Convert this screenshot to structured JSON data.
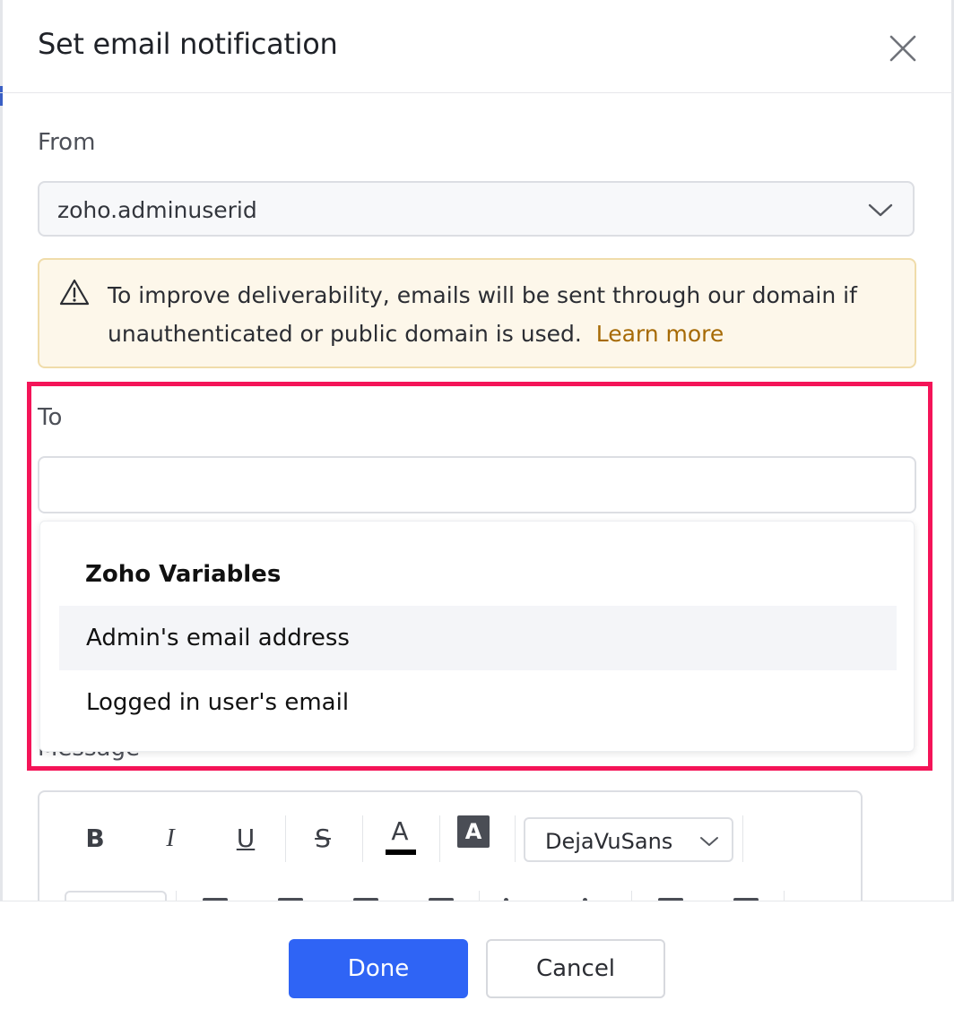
{
  "dialog": {
    "title": "Set email notification"
  },
  "from": {
    "label": "From",
    "selected": "zoho.adminuserid"
  },
  "warning": {
    "text": "To improve deliverability, emails will be sent through our domain if unauthenticated or public domain is used.",
    "link": "Learn more"
  },
  "to": {
    "label": "To",
    "value": ""
  },
  "dropdown": {
    "header": "Zoho Variables",
    "items": [
      {
        "label": "Admin's email address"
      },
      {
        "label": "Logged in user's email"
      }
    ]
  },
  "message": {
    "label": "Message"
  },
  "toolbar": {
    "bold": "B",
    "italic": "I",
    "underline": "U",
    "strike": "S",
    "text_color": "A",
    "bg_color": "A",
    "font": "DejaVuSans"
  },
  "footer": {
    "done": "Done",
    "cancel": "Cancel"
  },
  "colors": {
    "primary": "#2f64f5",
    "highlight": "#f41458",
    "warning_bg": "#fdf7ea",
    "link": "#a66a05"
  }
}
